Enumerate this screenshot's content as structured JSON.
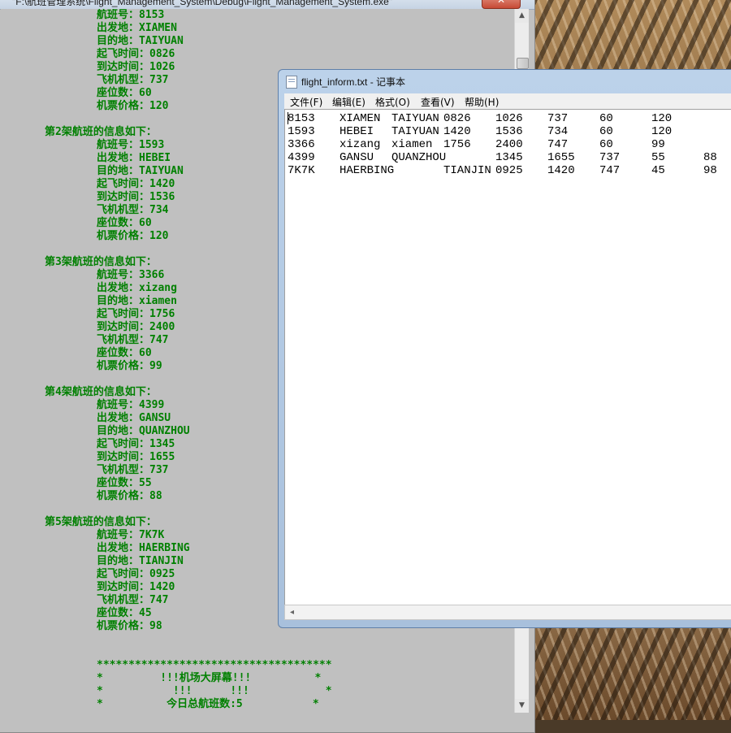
{
  "console": {
    "title": "\"F:\\航班管理系统\\Flight_Management_System\\Debug\\Flight_Management_System.exe\"",
    "close_label": "✕",
    "scroll_up": "▲",
    "scroll_down": "▼",
    "flight1_fields": [
      "航班号：8153",
      "出发地：XIAMEN",
      "目的地：TAIYUAN",
      "起飞时间：0826",
      "到达时间：1026",
      "飞机机型：737",
      "座位数：60",
      "机票价格：120"
    ],
    "flights": [
      {
        "header": "第2架航班的信息如下：",
        "fields": [
          "航班号：1593",
          "出发地：HEBEI",
          "目的地：TAIYUAN",
          "起飞时间：1420",
          "到达时间：1536",
          "飞机机型：734",
          "座位数：60",
          "机票价格：120"
        ]
      },
      {
        "header": "第3架航班的信息如下：",
        "fields": [
          "航班号：3366",
          "出发地：xizang",
          "目的地：xiamen",
          "起飞时间：1756",
          "到达时间：2400",
          "飞机机型：747",
          "座位数：60",
          "机票价格：99"
        ]
      },
      {
        "header": "第4架航班的信息如下：",
        "fields": [
          "航班号：4399",
          "出发地：GANSU",
          "目的地：QUANZHOU",
          "起飞时间：1345",
          "到达时间：1655",
          "飞机机型：737",
          "座位数：55",
          "机票价格：88"
        ]
      },
      {
        "header": "第5架航班的信息如下：",
        "fields": [
          "航班号：7K7K",
          "出发地：HAERBING",
          "目的地：TIANJIN",
          "起飞时间：0925",
          "到达时间：1420",
          "飞机机型：747",
          "座位数：45",
          "机票价格：98"
        ]
      }
    ],
    "screen_lines": [
      "*************************************",
      "*         !!!机场大屏幕!!!          *",
      "*           !!!      !!!            *",
      "*          今日总航班数:5           *"
    ]
  },
  "notepad": {
    "title": "flight_inform.txt - 记事本",
    "menu": [
      "文件(F)",
      "编辑(E)",
      "格式(O)",
      "查看(V)",
      "帮助(H)"
    ],
    "scroll_left": "◂",
    "rows": [
      [
        "8153",
        "XIAMEN",
        "TAIYUAN",
        "0826",
        "1026",
        "737",
        "60",
        "120",
        ""
      ],
      [
        "1593",
        "HEBEI",
        "TAIYUAN",
        "1420",
        "1536",
        "734",
        "60",
        "120",
        ""
      ],
      [
        "3366",
        "xizang",
        "xiamen",
        "1756",
        "2400",
        "747",
        "60",
        "99",
        ""
      ],
      [
        "4399",
        "GANSU",
        "QUANZHOU",
        "",
        "1345",
        "1655",
        "737",
        "55",
        "88"
      ],
      [
        "7K7K",
        "HAERBING",
        "",
        "TIANJIN",
        "0925",
        "1420",
        "747",
        "45",
        "98"
      ]
    ]
  },
  "colors": {
    "console_text": "#008000",
    "console_bg": "#c0c0c0"
  }
}
